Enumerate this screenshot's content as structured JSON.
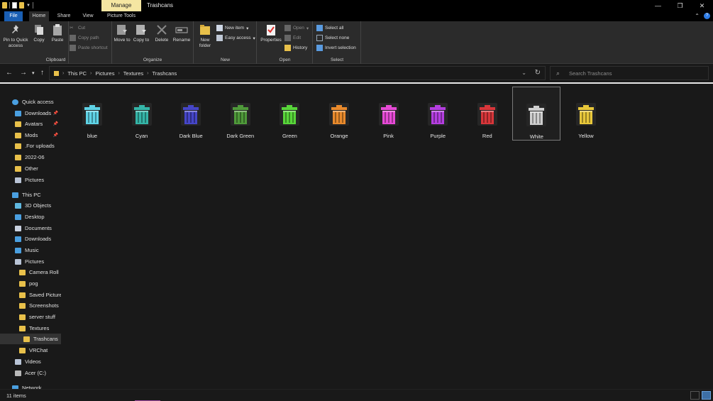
{
  "window": {
    "title": "Trashcans",
    "context_tab": "Manage",
    "controls": {
      "minimize": "—",
      "restore": "❐",
      "close": "✕"
    }
  },
  "ribbon_tabs": [
    "File",
    "Home",
    "Share",
    "View",
    "Picture Tools"
  ],
  "ribbon": {
    "clipboard": {
      "label": "Clipboard",
      "pin": "Pin to Quick access",
      "copy": "Copy",
      "paste": "Paste",
      "cut": "Cut",
      "copy_path": "Copy path",
      "paste_shortcut": "Paste shortcut"
    },
    "organize": {
      "label": "Organize",
      "move_to": "Move to",
      "copy_to": "Copy to",
      "delete": "Delete",
      "rename": "Rename"
    },
    "new": {
      "label": "New",
      "new_folder": "New folder",
      "new_item": "New item",
      "easy_access": "Easy access"
    },
    "open": {
      "label": "Open",
      "properties": "Properties",
      "open": "Open",
      "edit": "Edit",
      "history": "History"
    },
    "select": {
      "label": "Select",
      "select_all": "Select all",
      "select_none": "Select none",
      "invert": "Invert selection"
    }
  },
  "breadcrumb": [
    "This PC",
    "Pictures",
    "Textures",
    "Trashcans"
  ],
  "search": {
    "placeholder": "Search Trashcans"
  },
  "sidebar": {
    "items": [
      {
        "label": "Quick access",
        "icon": "star-icon",
        "indent": 0,
        "pinned": false
      },
      {
        "label": "Downloads",
        "icon": "download-icon",
        "indent": 1,
        "pinned": true
      },
      {
        "label": "Avatars",
        "icon": "folder-icon",
        "indent": 1,
        "pinned": true
      },
      {
        "label": "Mods",
        "icon": "folder-icon",
        "indent": 1,
        "pinned": true
      },
      {
        "label": ".For uploads",
        "icon": "folder-icon",
        "indent": 1,
        "pinned": false
      },
      {
        "label": "2022-06",
        "icon": "folder-icon",
        "indent": 1,
        "pinned": false
      },
      {
        "label": "Other",
        "icon": "folder-icon",
        "indent": 1,
        "pinned": false
      },
      {
        "label": "Pictures",
        "icon": "pictures-icon",
        "indent": 1,
        "pinned": false
      },
      {
        "label": "This PC",
        "icon": "computer-icon",
        "indent": 0,
        "pinned": false
      },
      {
        "label": "3D Objects",
        "icon": "cube-icon",
        "indent": 1,
        "pinned": false
      },
      {
        "label": "Desktop",
        "icon": "desktop-icon",
        "indent": 1,
        "pinned": false
      },
      {
        "label": "Documents",
        "icon": "document-icon",
        "indent": 1,
        "pinned": false
      },
      {
        "label": "Downloads",
        "icon": "download-icon",
        "indent": 1,
        "pinned": false
      },
      {
        "label": "Music",
        "icon": "music-icon",
        "indent": 1,
        "pinned": false
      },
      {
        "label": "Pictures",
        "icon": "pictures-icon",
        "indent": 1,
        "pinned": false
      },
      {
        "label": "Camera Roll",
        "icon": "folder-icon",
        "indent": 2,
        "pinned": false
      },
      {
        "label": "pog",
        "icon": "folder-icon",
        "indent": 2,
        "pinned": false
      },
      {
        "label": "Saved Pictures",
        "icon": "folder-icon",
        "indent": 2,
        "pinned": false
      },
      {
        "label": "Screenshots",
        "icon": "folder-icon",
        "indent": 2,
        "pinned": false
      },
      {
        "label": "server stuff",
        "icon": "folder-icon",
        "indent": 2,
        "pinned": false
      },
      {
        "label": "Textures",
        "icon": "folder-icon",
        "indent": 2,
        "pinned": false
      },
      {
        "label": "Trashcans",
        "icon": "folder-icon",
        "indent": 3,
        "pinned": false,
        "selected": true
      },
      {
        "label": "VRChat",
        "icon": "folder-icon",
        "indent": 2,
        "pinned": false
      },
      {
        "label": "Videos",
        "icon": "video-icon",
        "indent": 1,
        "pinned": false
      },
      {
        "label": "Acer (C:)",
        "icon": "drive-icon",
        "indent": 1,
        "pinned": false
      },
      {
        "label": "Network",
        "icon": "network-icon",
        "indent": 0,
        "pinned": false
      }
    ]
  },
  "files": [
    {
      "name": "blue",
      "color": "#5fd3e6"
    },
    {
      "name": "Cyan",
      "color": "#35b5a8"
    },
    {
      "name": "Dark Blue",
      "color": "#4646c8"
    },
    {
      "name": "Dark Green",
      "color": "#4f9a3a"
    },
    {
      "name": "Green",
      "color": "#58d63a"
    },
    {
      "name": "Orange",
      "color": "#e98a2c"
    },
    {
      "name": "Pink",
      "color": "#e64ad6"
    },
    {
      "name": "Purple",
      "color": "#b43ee0"
    },
    {
      "name": "Red",
      "color": "#d8363a"
    },
    {
      "name": "White",
      "color": "#cfcfcf",
      "selected": true
    },
    {
      "name": "Yellow",
      "color": "#e8c73a"
    }
  ],
  "status": {
    "item_count": "11 items"
  }
}
